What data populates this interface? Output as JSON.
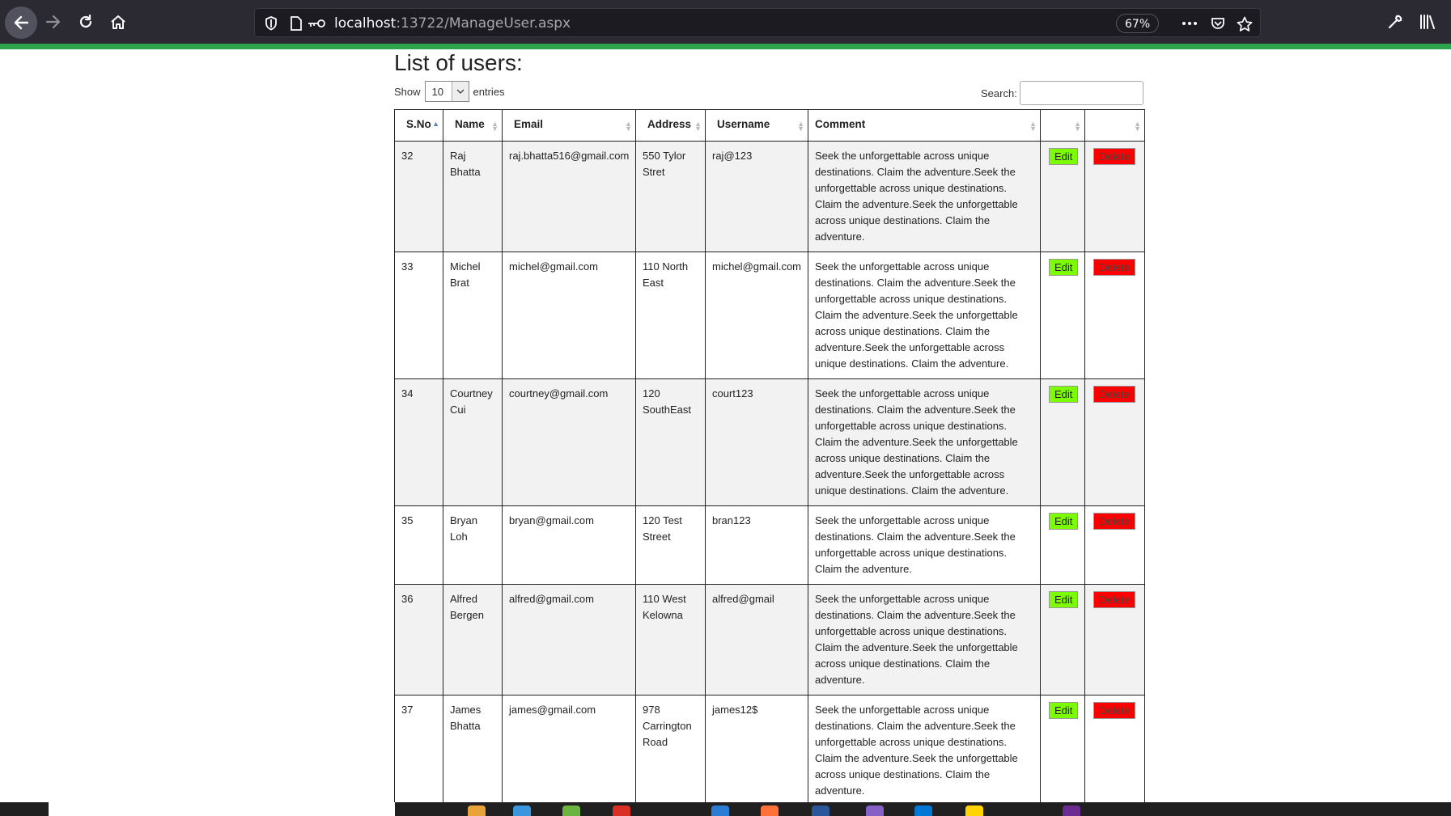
{
  "browser": {
    "url_host": "localhost",
    "url_rest": ":13722/ManageUser.aspx",
    "zoom": "67%"
  },
  "page": {
    "title": "List of users:",
    "length_label_before": "Show",
    "length_value": "10",
    "length_label_after": "entries",
    "search_label": "Search:",
    "search_value": ""
  },
  "table": {
    "columns": [
      "S.No",
      "Name",
      "Email",
      "Address",
      "Username",
      "Comment",
      "",
      ""
    ],
    "edit_label": "Edit",
    "delete_label": "Delete",
    "rows": [
      {
        "sno": "32",
        "name": "Raj Bhatta",
        "email": "raj.bhatta516@gmail.com",
        "address": "550 Tylor Stret",
        "username": "raj@123",
        "comment": "Seek the unforgettable across unique destinations. Claim the adventure.Seek the unforgettable across unique destinations. Claim the adventure.Seek the unforgettable across unique destinations. Claim the adventure."
      },
      {
        "sno": "33",
        "name": "Michel Brat",
        "email": "michel@gmail.com",
        "address": "110 North East",
        "username": "michel@gmail.com",
        "comment": "Seek the unforgettable across unique destinations. Claim the adventure.Seek the unforgettable across unique destinations. Claim the adventure.Seek the unforgettable across unique destinations. Claim the adventure.Seek the unforgettable across unique destinations. Claim the adventure."
      },
      {
        "sno": "34",
        "name": "Courtney Cui",
        "email": "courtney@gmail.com",
        "address": "120 SouthEast",
        "username": "court123",
        "comment": "Seek the unforgettable across unique destinations. Claim the adventure.Seek the unforgettable across unique destinations. Claim the adventure.Seek the unforgettable across unique destinations. Claim the adventure.Seek the unforgettable across unique destinations. Claim the adventure."
      },
      {
        "sno": "35",
        "name": "Bryan Loh",
        "email": "bryan@gmail.com",
        "address": "120 Test Street",
        "username": "bran123",
        "comment": "Seek the unforgettable across unique destinations. Claim the adventure.Seek the unforgettable across unique destinations. Claim the adventure."
      },
      {
        "sno": "36",
        "name": "Alfred Bergen",
        "email": "alfred@gmail.com",
        "address": "110 West Kelowna",
        "username": "alfred@gmail",
        "comment": "Seek the unforgettable across unique destinations. Claim the adventure.Seek the unforgettable across unique destinations. Claim the adventure.Seek the unforgettable across unique destinations. Claim the adventure."
      },
      {
        "sno": "37",
        "name": "James Bhatta",
        "email": "james@gmail.com",
        "address": "978 Carrington Road",
        "username": "james12$",
        "comment": "Seek the unforgettable across unique destinations. Claim the adventure.Seek the unforgettable across unique destinations. Claim the adventure.Seek the unforgettable across unique destinations. Claim the adventure."
      }
    ]
  },
  "colors": {
    "edit_button": "#7cfc00",
    "delete_button": "#ff0000",
    "toolbar": "#2b2a33",
    "accent_bar": "#2da44e"
  },
  "icons": [
    "back-icon",
    "forward-icon",
    "reload-icon",
    "home-icon",
    "shield-icon",
    "page-icon",
    "key-icon",
    "more-icon",
    "pocket-icon",
    "star-icon",
    "wrench-icon",
    "library-icon"
  ]
}
